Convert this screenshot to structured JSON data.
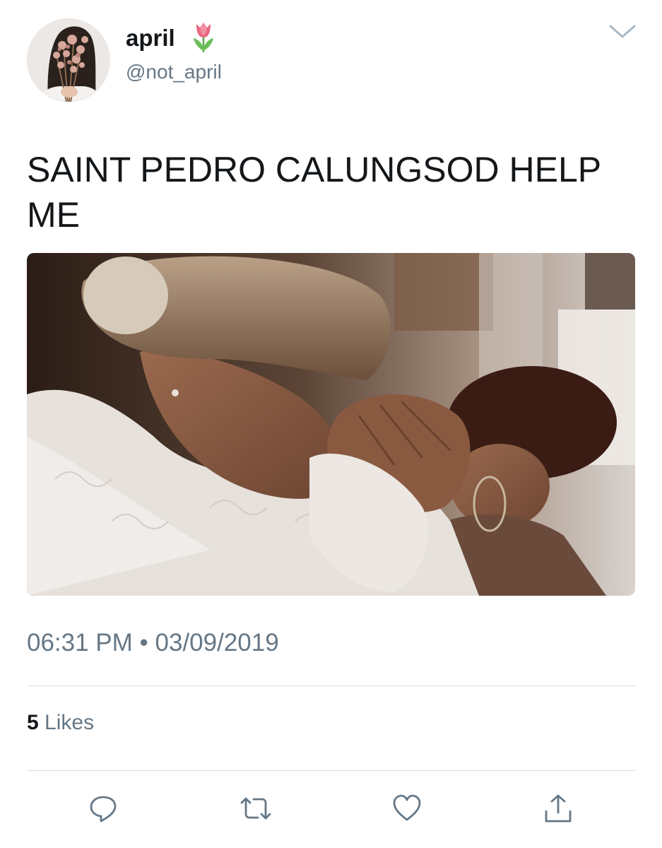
{
  "user": {
    "display_name": "april",
    "name_emoji": "tulip",
    "handle": "@not_april",
    "avatar": "dried-flowers-portrait"
  },
  "header": {
    "menu_icon": "chevron-down-icon"
  },
  "tweet": {
    "text": "SAINT PEDRO CALUNGSOD HELP ME",
    "media": "photo-two-women-praying",
    "timestamp": "06:31 PM • 03/09/2019"
  },
  "stats": {
    "likes_count": "5",
    "likes_label": "Likes"
  },
  "actions": [
    {
      "name": "reply",
      "icon": "reply-icon"
    },
    {
      "name": "retweet",
      "icon": "retweet-icon"
    },
    {
      "name": "like",
      "icon": "heart-icon"
    },
    {
      "name": "share",
      "icon": "share-icon"
    }
  ],
  "colors": {
    "text_primary": "#14171a",
    "text_secondary": "#657786",
    "icon": "#657786",
    "divider": "#d9dde0"
  }
}
